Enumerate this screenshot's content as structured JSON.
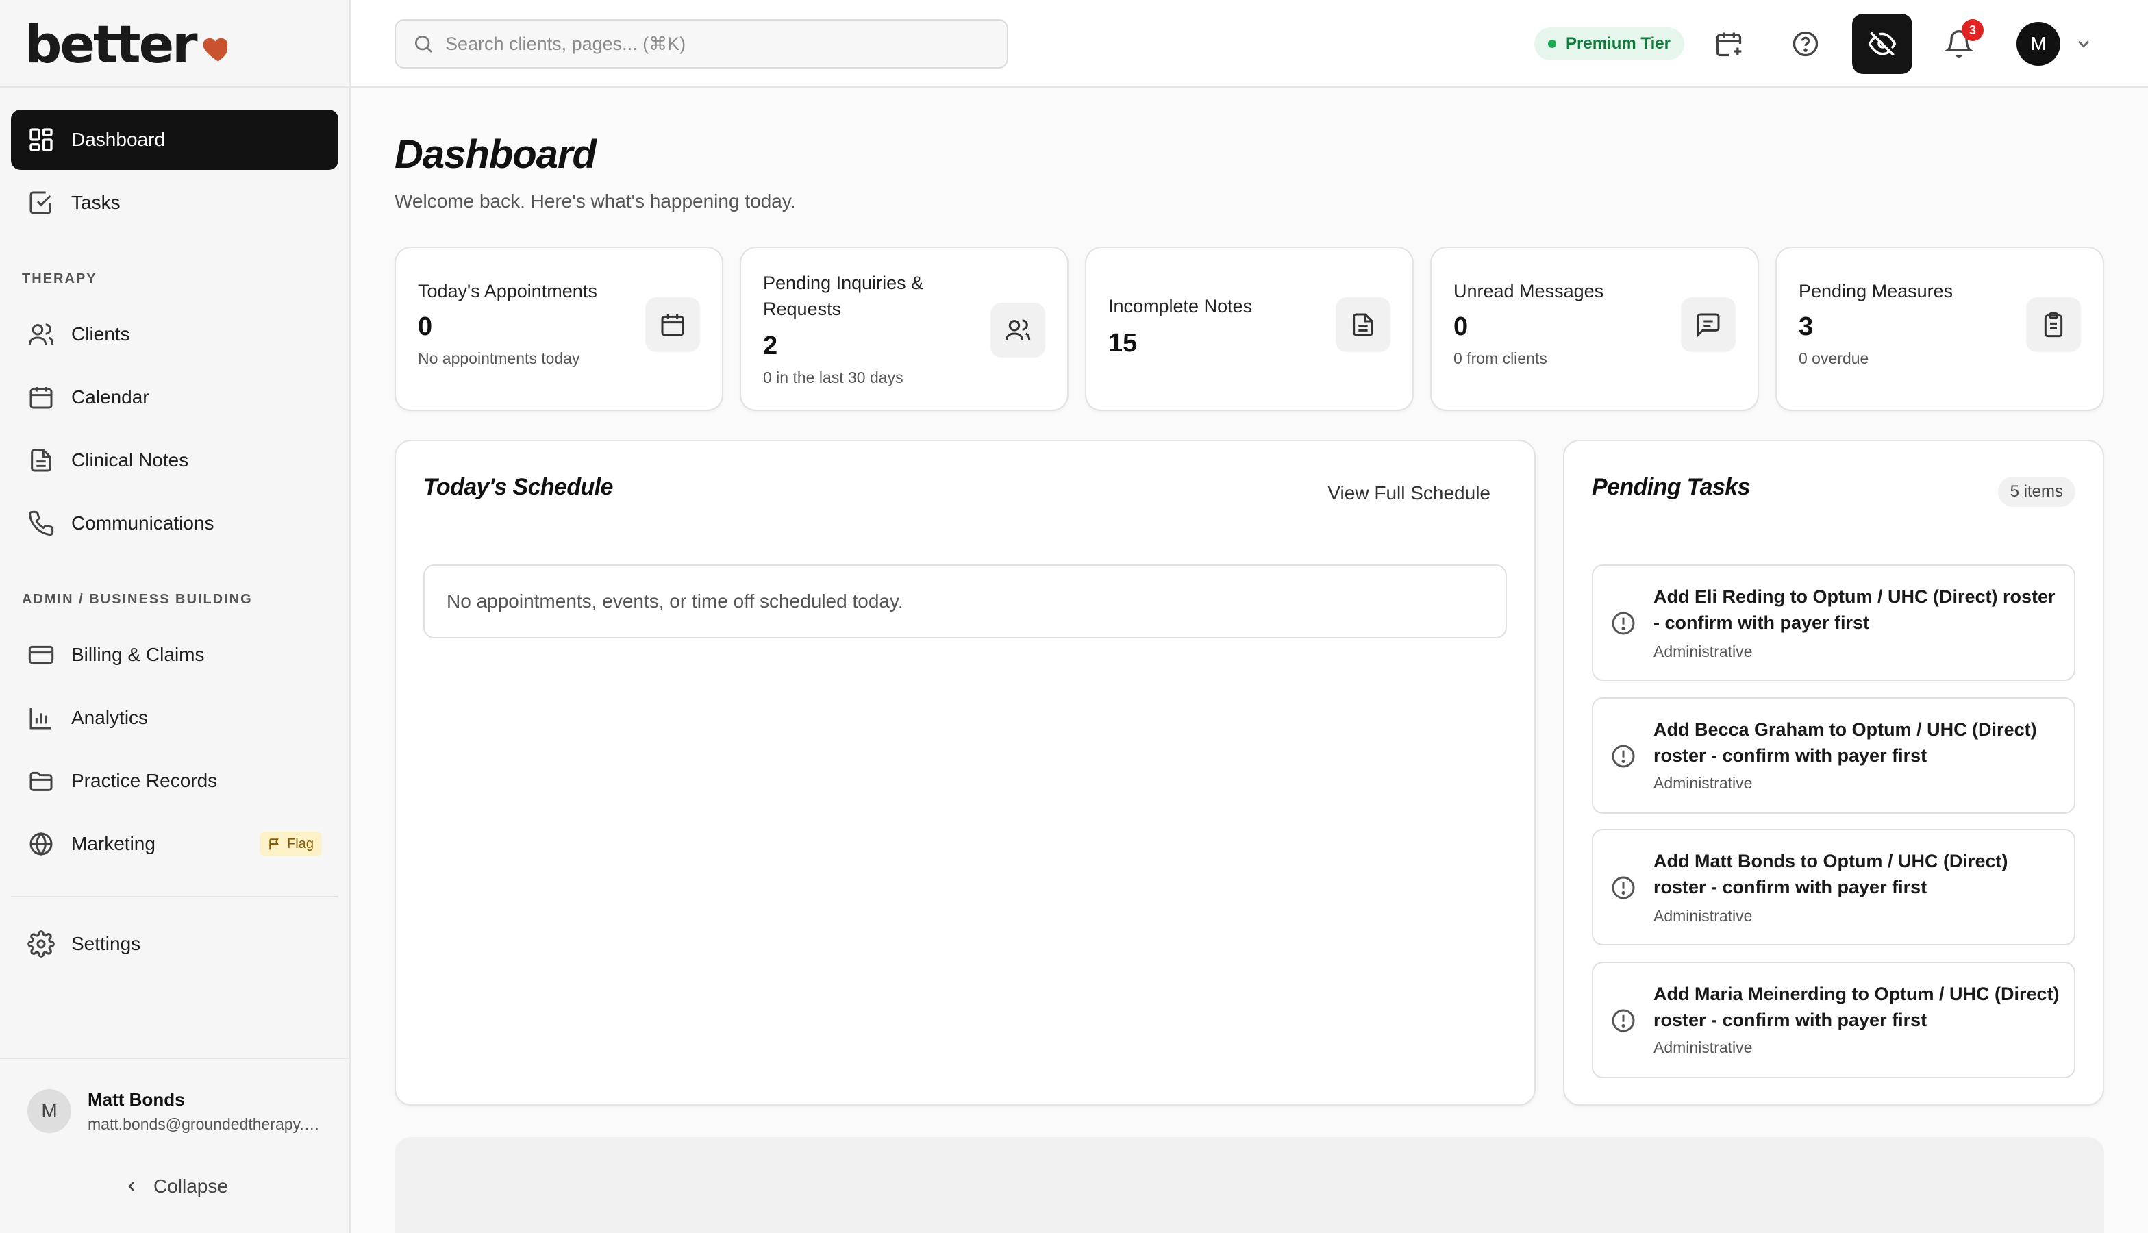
{
  "brand": {
    "name": "better",
    "accent": "#c8532e"
  },
  "sidebar": {
    "primary": [
      {
        "label": "Dashboard",
        "icon": "dashboard-grid-icon",
        "active": true
      },
      {
        "label": "Tasks",
        "icon": "check-square-icon"
      }
    ],
    "therapy_label": "THERAPY",
    "therapy": [
      {
        "label": "Clients",
        "icon": "users-icon"
      },
      {
        "label": "Calendar",
        "icon": "calendar-icon"
      },
      {
        "label": "Clinical Notes",
        "icon": "file-text-icon"
      },
      {
        "label": "Communications",
        "icon": "phone-icon"
      }
    ],
    "admin_label": "ADMIN / BUSINESS BUILDING",
    "admin": [
      {
        "label": "Billing & Claims",
        "icon": "credit-card-icon"
      },
      {
        "label": "Analytics",
        "icon": "bar-chart-icon"
      },
      {
        "label": "Practice Records",
        "icon": "folder-icon"
      },
      {
        "label": "Marketing",
        "icon": "globe-icon",
        "badge": "Flag"
      }
    ],
    "settings": {
      "label": "Settings",
      "icon": "gear-icon"
    },
    "user": {
      "initial": "M",
      "name": "Matt Bonds",
      "email": "matt.bonds@groundedtherapy.com"
    },
    "collapse_label": "Collapse"
  },
  "topbar": {
    "search_placeholder": "Search clients, pages... (⌘K)",
    "tier_label": "Premium Tier",
    "notification_count": "3",
    "avatar_initial": "M"
  },
  "page": {
    "title": "Dashboard",
    "subtitle": "Welcome back. Here's what's happening today."
  },
  "stats": [
    {
      "label": "Today's Appointments",
      "value": "0",
      "sub": "No appointments today",
      "icon": "calendar-icon"
    },
    {
      "label": "Pending Inquiries & Requests",
      "value": "2",
      "sub": "0 in the last 30 days",
      "icon": "users-icon"
    },
    {
      "label": "Incomplete Notes",
      "value": "15",
      "sub": "",
      "icon": "file-text-icon"
    },
    {
      "label": "Unread Messages",
      "value": "0",
      "sub": "0 from clients",
      "icon": "message-square-icon"
    },
    {
      "label": "Pending Measures",
      "value": "3",
      "sub": "0 overdue",
      "icon": "clipboard-icon"
    }
  ],
  "schedule": {
    "title": "Today's Schedule",
    "link": "View Full Schedule",
    "empty": "No appointments, events, or time off scheduled today."
  },
  "tasks": {
    "title": "Pending Tasks",
    "count": "5 items",
    "items": [
      {
        "title": "Add Eli Reding to Optum / UHC (Direct) roster - confirm with payer first",
        "category": "Administrative"
      },
      {
        "title": "Add Becca Graham to Optum / UHC (Direct) roster - confirm with payer first",
        "category": "Administrative"
      },
      {
        "title": "Add Matt Bonds to Optum / UHC (Direct) roster - confirm with payer first",
        "category": "Administrative"
      },
      {
        "title": "Add Maria Meinerding to Optum / UHC (Direct) roster - confirm with payer first",
        "category": "Administrative"
      }
    ]
  }
}
